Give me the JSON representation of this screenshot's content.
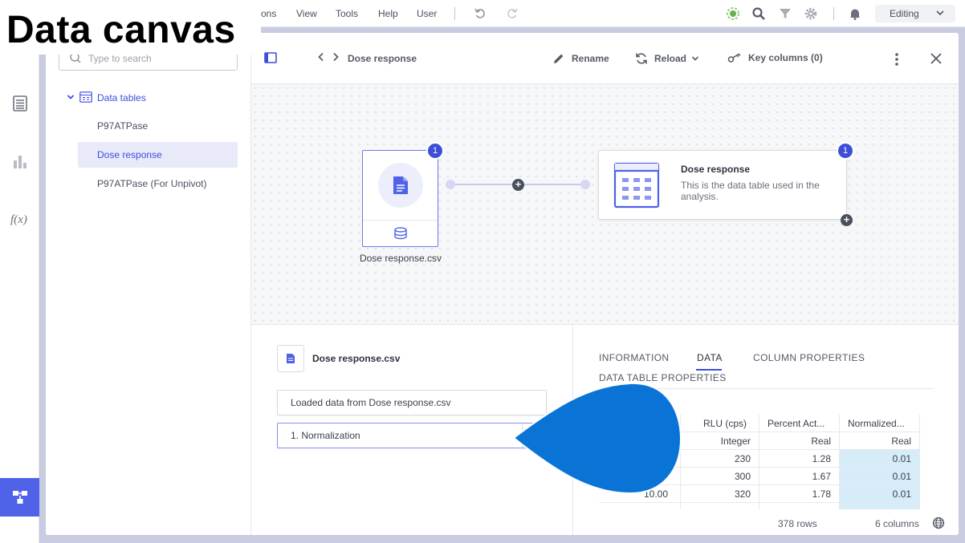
{
  "overlay_title": "Data canvas",
  "menu": {
    "items": [
      "ons",
      "View",
      "Tools",
      "Help",
      "User"
    ],
    "mode": "Editing"
  },
  "sidebar": {
    "search_placeholder": "Type to search",
    "root_label": "Data tables",
    "items": [
      {
        "label": "P97ATPase",
        "selected": false
      },
      {
        "label": "Dose response",
        "selected": true
      },
      {
        "label": "P97ATPase (For Unpivot)",
        "selected": false
      }
    ]
  },
  "header": {
    "breadcrumb": "Dose response",
    "rename_label": "Rename",
    "reload_label": "Reload",
    "key_columns_label": "Key columns (0)"
  },
  "canvas": {
    "source_node": {
      "label": "Dose response.csv",
      "badge": "1"
    },
    "target_node": {
      "title": "Dose response",
      "description": "This is the data table used in the analysis.",
      "badge": "1"
    }
  },
  "details": {
    "file_title": "Dose response.csv",
    "steps": [
      "Loaded data from Dose response.csv",
      "1. Normalization"
    ]
  },
  "data_view": {
    "tabs": [
      "INFORMATION",
      "DATA",
      "COLUMN PROPERTIES",
      "DATA TABLE PROPERTIES"
    ],
    "active_tab": "DATA",
    "columns": [
      "RLU (cps)",
      "Percent Act...",
      "Normalized..."
    ],
    "types": [
      "Integer",
      "Real",
      "Real"
    ],
    "rows": [
      [
        "",
        "230",
        "1.28",
        "0.01"
      ],
      [
        "",
        "300",
        "1.67",
        "0.01"
      ],
      [
        "10.00",
        "320",
        "1.78",
        "0.01"
      ]
    ],
    "row_count": "378 rows",
    "column_count": "6 columns"
  },
  "colors": {
    "accent": "#3d4fd8",
    "rail_active": "#4f62e8",
    "callout": "#0a74d6",
    "selected_cell": "#d6ecf8"
  }
}
